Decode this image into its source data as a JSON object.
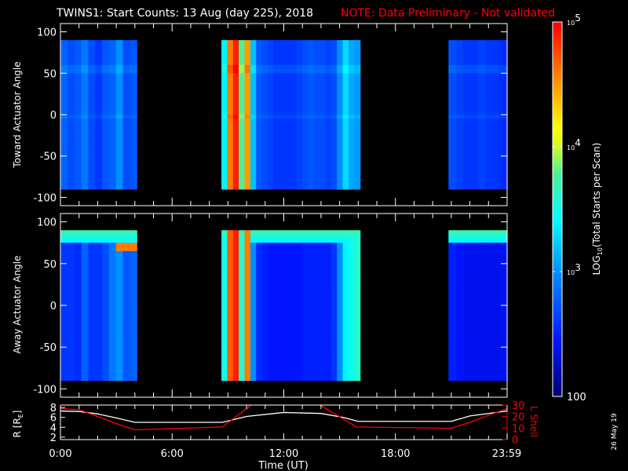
{
  "title": {
    "main": "TWINS1: Start Counts: 13 Aug (day 225), 2018",
    "note": "NOTE: Data Preliminary - Not validated",
    "note_color": "#ff0000"
  },
  "date_stamp": "26 May 19",
  "chart_data": {
    "type": "heatmap",
    "x_ticks": [
      {
        "h": 0,
        "label": "0:00"
      },
      {
        "h": 6,
        "label": "6:00"
      },
      {
        "h": 12,
        "label": "12:00"
      },
      {
        "h": 18,
        "label": "18:00"
      },
      {
        "h": 23.98,
        "label": "23:59"
      }
    ],
    "xlabel": "Time (UT)",
    "xlim_hours": [
      0,
      24
    ],
    "panels": [
      {
        "ylabel": "Toward Actuator Angle",
        "ylim": [
          -110,
          110
        ],
        "y_ticks": [
          "100",
          "50",
          "0",
          "-50",
          "-100"
        ],
        "y_tick_values": [
          100,
          50,
          0,
          -50,
          -100
        ],
        "data_range": [
          -90,
          90
        ],
        "segments": [
          {
            "start_h": 0.0,
            "end_h": 4.1,
            "log10_counts": [
              2.8,
              2.7,
              2.75,
              2.9,
              2.7,
              2.6,
              2.75,
              2.8,
              3.0,
              2.7,
              2.75
            ]
          },
          {
            "start_h": 8.65,
            "end_h": 16.1,
            "log10_counts": [
              3.4,
              4.6,
              4.9,
              3.8,
              4.5,
              3.2,
              2.75,
              2.7,
              2.65,
              2.6,
              2.6,
              2.6,
              2.6,
              2.65,
              2.7,
              2.75,
              2.7,
              2.7,
              2.65,
              2.7,
              3.0,
              3.3,
              3.1,
              3.05
            ]
          },
          {
            "start_h": 20.85,
            "end_h": 24.0,
            "log10_counts": [
              2.7,
              2.65,
              2.6,
              2.6,
              2.65,
              2.6,
              2.6,
              2.55
            ]
          }
        ]
      },
      {
        "ylabel": "Away Actuator Angle",
        "ylim": [
          -110,
          110
        ],
        "y_ticks": [
          "100",
          "50",
          "0",
          "-50",
          "-100"
        ],
        "y_tick_values": [
          100,
          50,
          0,
          -50,
          -100
        ],
        "data_range": [
          -90,
          90
        ],
        "segments": [
          {
            "start_h": 0.0,
            "end_h": 4.1,
            "log10_counts": [
              2.6,
              2.6,
              2.55,
              2.8,
              2.6,
              2.6,
              2.7,
              2.9,
              3.0,
              2.75,
              2.8
            ]
          },
          {
            "start_h": 8.65,
            "end_h": 16.1,
            "log10_counts": [
              3.5,
              4.7,
              4.9,
              3.6,
              4.6,
              3.0,
              2.55,
              2.5,
              2.45,
              2.45,
              2.45,
              2.45,
              2.45,
              2.45,
              2.5,
              2.5,
              2.5,
              2.5,
              2.5,
              2.6,
              3.0,
              3.4,
              3.5,
              3.6
            ]
          },
          {
            "start_h": 20.85,
            "end_h": 24.0,
            "log10_counts": [
              2.5,
              2.45,
              2.4,
              2.4,
              2.4,
              2.4,
              2.4,
              2.4
            ]
          }
        ]
      }
    ],
    "colorbar": {
      "label": "LOG10(Total Starts per Scan)",
      "label_main": "LOG",
      "label_sub": "10",
      "label_rest": "(Total Starts per Scan)",
      "range_log10": [
        2,
        5
      ],
      "ticks": [
        {
          "v": 5,
          "base": "10",
          "exp": "5"
        },
        {
          "v": 4,
          "base": "10",
          "exp": "4"
        },
        {
          "v": 3,
          "base": "10",
          "exp": "3"
        },
        {
          "v": 2,
          "base": "100",
          "exp": ""
        }
      ]
    },
    "ephemeris": {
      "left_label": "R [R",
      "left_sub": "E",
      "left_close": "]",
      "left_ylim": [
        1.5,
        8.5
      ],
      "left_ticks": [
        "8",
        "6",
        "4",
        "2"
      ],
      "left_tick_values": [
        8,
        6,
        4,
        2
      ],
      "right_label": "L Shell",
      "right_ylim": [
        0,
        30
      ],
      "right_ticks": [
        "30",
        "20",
        "10",
        "0"
      ],
      "right_tick_values": [
        30,
        20,
        10,
        0
      ],
      "series": [
        {
          "name": "R",
          "color": "#ffffff",
          "axis": "left",
          "points": [
            [
              0,
              7.3
            ],
            [
              1,
              7.2
            ],
            [
              2,
              6.7
            ],
            [
              3,
              5.9
            ],
            [
              4,
              5.0
            ],
            [
              8.7,
              5.0
            ],
            [
              10,
              6.2
            ],
            [
              12,
              7.0
            ],
            [
              14,
              6.8
            ],
            [
              15.2,
              6.0
            ],
            [
              16,
              5.2
            ],
            [
              21,
              5.2
            ],
            [
              22,
              6.3
            ],
            [
              24,
              7.3
            ]
          ]
        },
        {
          "name": "L Shell",
          "color": "#ff0000",
          "axis": "right",
          "points": [
            [
              0,
              27
            ],
            [
              1,
              26
            ],
            [
              2,
              20
            ],
            [
              3,
              14
            ],
            [
              4,
              8.5
            ],
            [
              6,
              9.5
            ],
            [
              8.7,
              11
            ],
            [
              10.3,
              30.5
            ]
          ],
          "points2": [
            [
              13.9,
              30.5
            ],
            [
              15.9,
              11
            ],
            [
              18,
              10.5
            ],
            [
              21,
              9.8
            ],
            [
              22,
              15
            ],
            [
              23,
              21
            ],
            [
              24,
              27
            ]
          ]
        }
      ]
    }
  }
}
